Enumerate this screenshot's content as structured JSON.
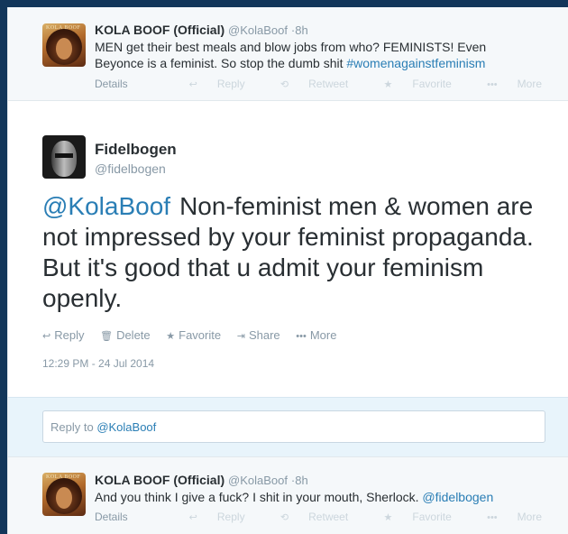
{
  "top_tweet": {
    "avatar_label": "KOLA BOOF",
    "name": "KOLA BOOF (Official)",
    "handle": "@KolaBoof",
    "separator": "·",
    "time": "8h",
    "text_line1": "MEN get their best meals and blow jobs from who? FEMINISTS! Even",
    "text_line2_prefix": "Beyonce is a feminist. So stop the dumb shit ",
    "hashtag": "#womenagainstfeminism",
    "details": "Details",
    "actions": [
      "Reply",
      "Retweet",
      "Favorite",
      "More"
    ]
  },
  "main_tweet": {
    "name": "Fidelbogen",
    "handle": "@fidelbogen",
    "mention": "@KolaBoof",
    "text": "Non-feminist men & women are not impressed by your feminist propaganda. But it's good that u admit your feminism openly.",
    "actions": [
      "Reply",
      "Delete",
      "Favorite",
      "Share",
      "More"
    ],
    "timestamp": "12:29 PM - 24 Jul 2014"
  },
  "reply_box": {
    "prefix": "Reply to ",
    "mention": "@KolaBoof"
  },
  "bottom_tweet": {
    "avatar_label": "KOLA BOOF",
    "name": "KOLA BOOF (Official)",
    "handle": "@KolaBoof",
    "separator": "·",
    "time": "8h",
    "text_prefix": "And you think I give a fuck? I shit in your mouth, Sherlock. ",
    "mention": "@fidelbogen",
    "details": "Details",
    "actions": [
      "Reply",
      "Retweet",
      "Favorite",
      "More"
    ]
  }
}
